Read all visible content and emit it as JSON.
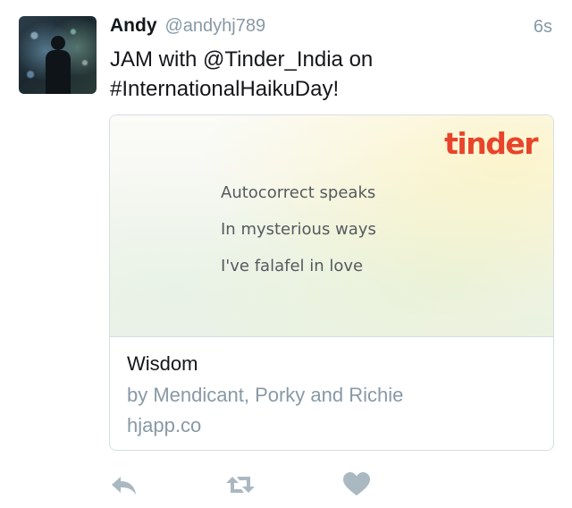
{
  "tweet": {
    "author_name": "Andy",
    "author_handle": "@andyhj789",
    "timestamp": "6s",
    "text_line1": "JAM with @Tinder_India on",
    "text_line2": "#InternationalHaikuDay!"
  },
  "card": {
    "logo_text": "tinder",
    "haiku": [
      "Autocorrect speaks",
      "In mysterious ways",
      "I've falafel in love"
    ],
    "title": "Wisdom",
    "description": "by Mendicant, Porky and Richie",
    "domain": "hjapp.co"
  },
  "actions": {
    "reply_icon": "reply-icon",
    "retweet_icon": "retweet-icon",
    "like_icon": "heart-icon",
    "icon_color": "#aab8c2"
  },
  "colors": {
    "secondary_text": "#8899a6",
    "tinder_brand": "#e8442c",
    "border": "#d7dde2"
  }
}
